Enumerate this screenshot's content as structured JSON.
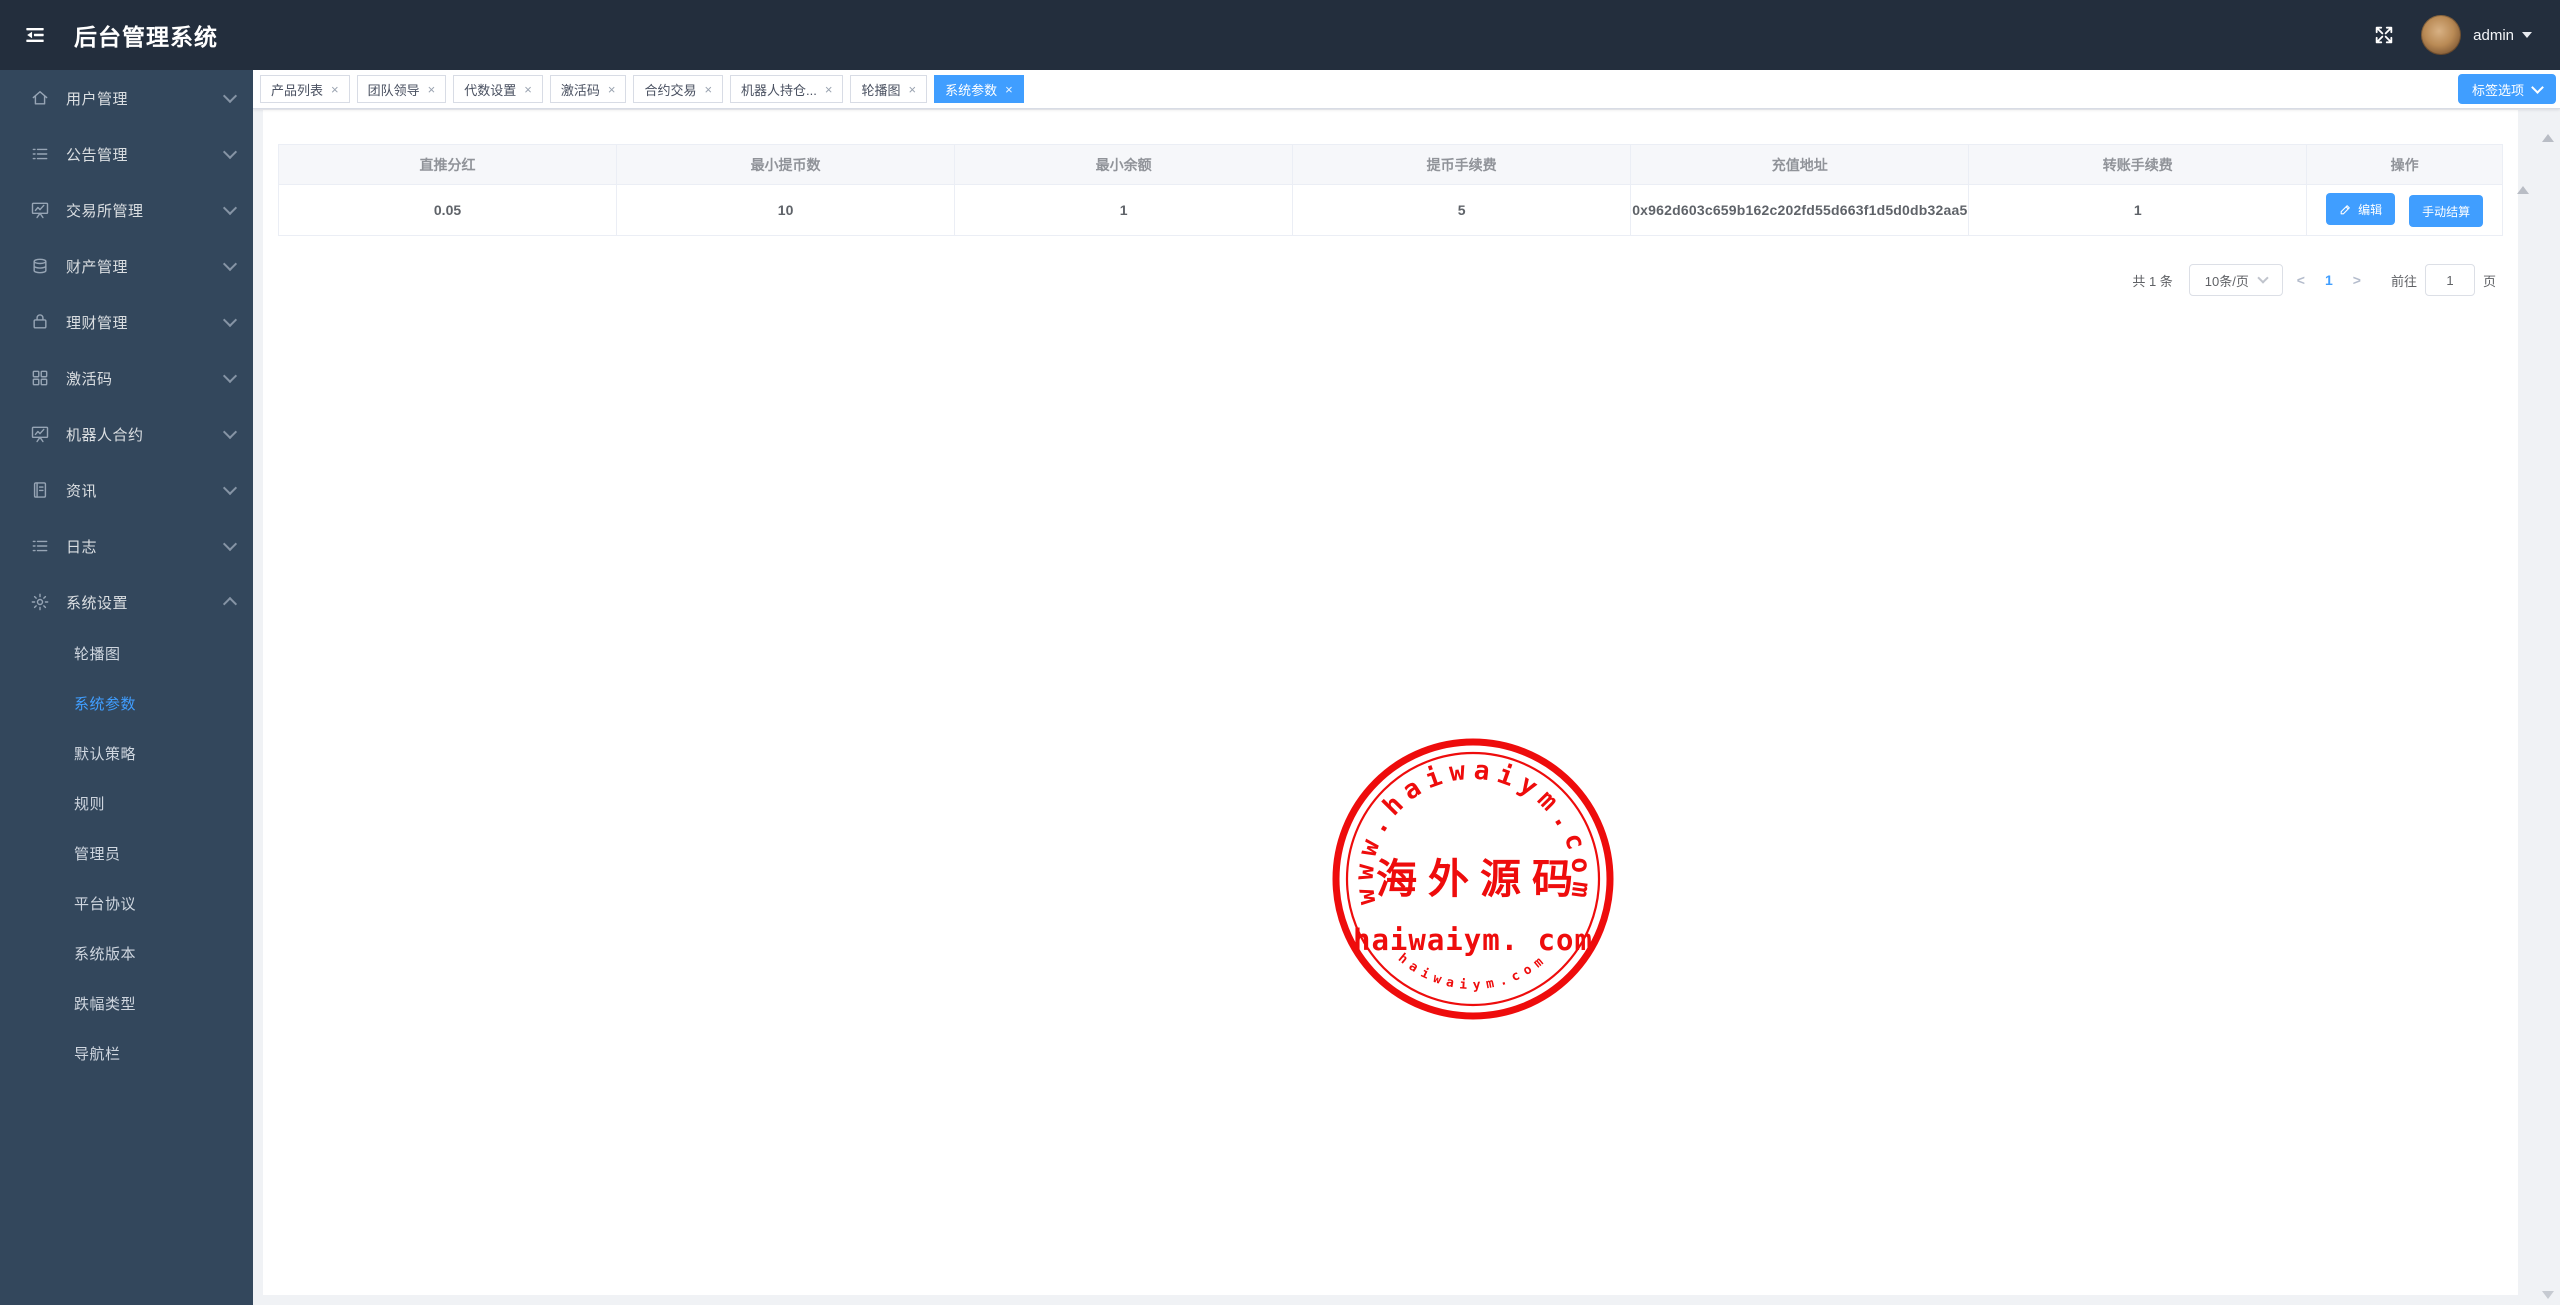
{
  "header": {
    "title": "后台管理系统",
    "username": "admin"
  },
  "sidebar": {
    "items": [
      {
        "label": "用户管理",
        "icon": "home-icon"
      },
      {
        "label": "公告管理",
        "icon": "list-icon"
      },
      {
        "label": "交易所管理",
        "icon": "chart-board-icon"
      },
      {
        "label": "财产管理",
        "icon": "coins-icon"
      },
      {
        "label": "理财管理",
        "icon": "bag-icon"
      },
      {
        "label": "激活码",
        "icon": "grid-icon"
      },
      {
        "label": "机器人合约",
        "icon": "chart-board-icon"
      },
      {
        "label": "资讯",
        "icon": "document-icon"
      },
      {
        "label": "日志",
        "icon": "list-icon"
      },
      {
        "label": "系统设置",
        "icon": "gear-icon",
        "expanded": true
      }
    ],
    "submenu": {
      "items": [
        "轮播图",
        "系统参数",
        "默认策略",
        "规则",
        "管理员",
        "平台协议",
        "系统版本",
        "跌幅类型",
        "导航栏"
      ],
      "active": "系统参数"
    }
  },
  "tabs": {
    "items": [
      {
        "label": "产品列表"
      },
      {
        "label": "团队领导"
      },
      {
        "label": "代数设置"
      },
      {
        "label": "激活码"
      },
      {
        "label": "合约交易"
      },
      {
        "label": "机器人持仓..."
      },
      {
        "label": "轮播图"
      },
      {
        "label": "系统参数",
        "active": true
      }
    ],
    "options_button": "标签选项"
  },
  "table": {
    "headers": [
      "直推分红",
      "最小提币数",
      "最小余额",
      "提币手续费",
      "充值地址",
      "转账手续费",
      "操作"
    ],
    "rows": [
      [
        "0.05",
        "10",
        "1",
        "5",
        "0x962d603c659b162c202fd55d663f1d5d0db32aa5",
        "1"
      ]
    ],
    "actions": {
      "edit": "编辑",
      "settle": "手动结算"
    }
  },
  "pagination": {
    "total": "共 1 条",
    "page_size": "10条/页",
    "current_page": "1",
    "goto_label": "前往",
    "goto_value": "1",
    "unit_label": "页"
  },
  "watermark": {
    "arc_top": "www.haiwaiym.com",
    "center": "海外源码",
    "line": "haiwaiym. com",
    "arc_bottom": "haiwaiym.com"
  },
  "colors": {
    "accent": "#409eff",
    "header_bg": "#232e3d",
    "sidebar_bg": "#33475c",
    "stamp_red": "#ee0c0c"
  }
}
